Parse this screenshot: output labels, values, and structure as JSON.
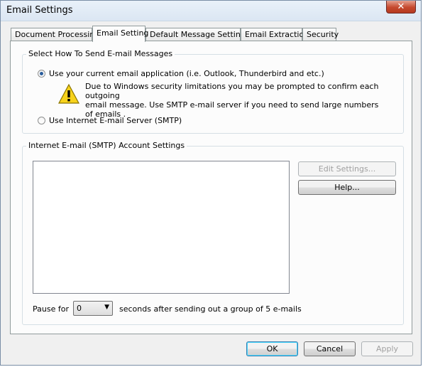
{
  "window": {
    "title": "Email Settings",
    "close_glyph": "✕"
  },
  "tabs": [
    {
      "label": "Document Processing"
    },
    {
      "label": "Email Setting"
    },
    {
      "label": "Default Message Settings"
    },
    {
      "label": "Email Extraction"
    },
    {
      "label": "Security"
    }
  ],
  "send_group": {
    "label": "Select How To Send E-mail Messages",
    "option_current": "Use your current email application (i.e. Outlook, Thunderbird and etc.)",
    "option_current_checked": true,
    "warning_line1": "Due to Windows security limitations you may be prompted to confirm each outgoing",
    "warning_line2": "email message. Use SMTP e-mail server if you need to send large numbers of emails .",
    "warning_icon": "warning-icon",
    "option_smtp": "Use Internet E-mail Server (SMTP)"
  },
  "smtp_group": {
    "label": "Internet E-mail (SMTP) Account Settings",
    "edit_button": "Edit Settings...",
    "help_button": "Help...",
    "pause_label": "Pause for",
    "pause_value": "0",
    "pause_suffix": "seconds after sending out a group of 5 e-mails"
  },
  "footer": {
    "ok": "OK",
    "cancel": "Cancel",
    "apply": "Apply"
  }
}
